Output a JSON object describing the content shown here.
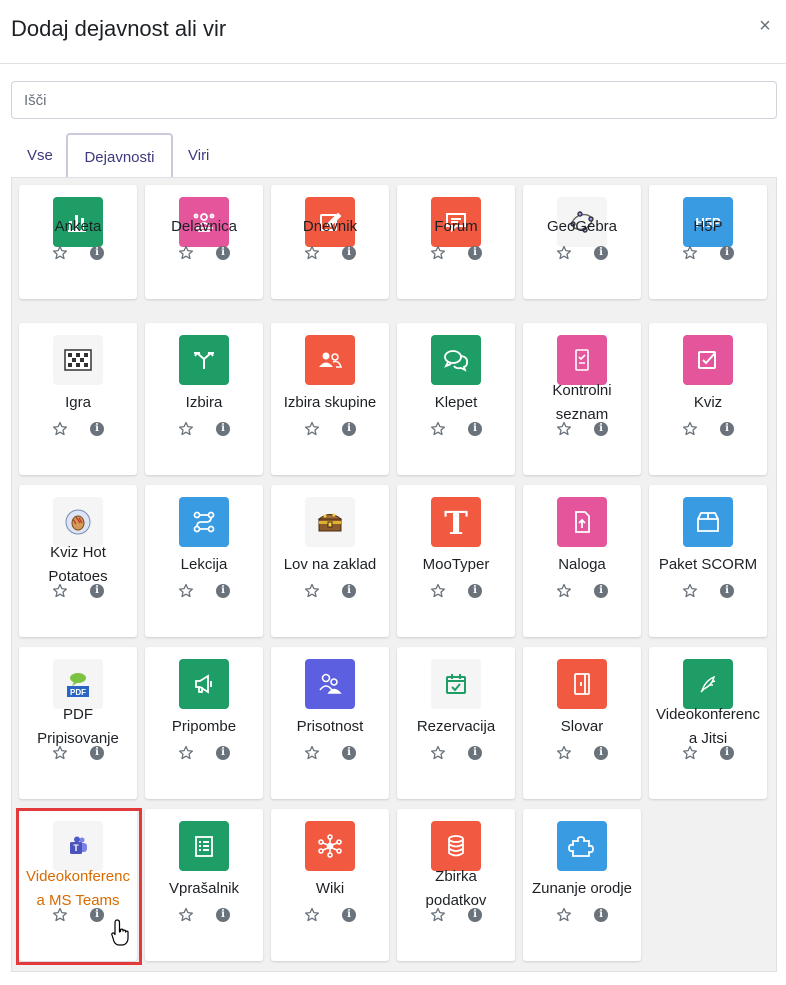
{
  "modal": {
    "title": "Dodaj dejavnost ali vir",
    "close_glyph": "×"
  },
  "search": {
    "placeholder": "Išči",
    "value": ""
  },
  "tabs": [
    {
      "label": "Vse",
      "active": false
    },
    {
      "label": "Dejavnosti",
      "active": true
    },
    {
      "label": "Viri",
      "active": false
    }
  ],
  "colors": {
    "green": "#1f9d67",
    "pink": "#e4559b",
    "red": "#f15a40",
    "blue": "#399be2",
    "purple": "#5b5fe0",
    "light": "#f5f5f5",
    "highlight": "#e23a3a",
    "highlight_text": "#d86a00"
  },
  "activities": [
    {
      "name": "Anketa",
      "icon": "chart-bar-icon",
      "color": "green"
    },
    {
      "name": "Delavnica",
      "icon": "people-icon",
      "color": "pink"
    },
    {
      "name": "Dnevnik",
      "icon": "edit-icon",
      "color": "red"
    },
    {
      "name": "Forum",
      "icon": "chat-bubble-icon",
      "color": "red"
    },
    {
      "name": "GeoGebra",
      "icon": "geogebra-icon",
      "color": "light"
    },
    {
      "name": "H5P",
      "icon": "h5p-icon",
      "color": "blue"
    },
    {
      "name": "Igra",
      "icon": "crossword-icon",
      "color": "light"
    },
    {
      "name": "Izbira",
      "icon": "signpost-icon",
      "color": "green"
    },
    {
      "name": "Izbira skupine",
      "icon": "group-icon",
      "color": "red"
    },
    {
      "name": "Klepet",
      "icon": "chat-icon",
      "color": "green"
    },
    {
      "name": "Kontrolni seznam",
      "icon": "checklist-icon",
      "color": "pink"
    },
    {
      "name": "Kviz",
      "icon": "checkbox-icon",
      "color": "pink"
    },
    {
      "name": "Kviz Hot Potatoes",
      "icon": "hot-potatoes-icon",
      "color": "light"
    },
    {
      "name": "Lekcija",
      "icon": "route-icon",
      "color": "blue"
    },
    {
      "name": "Lov na zaklad",
      "icon": "treasure-chest-icon",
      "color": "light"
    },
    {
      "name": "MooTyper",
      "icon": "letter-t-icon",
      "color": "red"
    },
    {
      "name": "Naloga",
      "icon": "file-upload-icon",
      "color": "pink"
    },
    {
      "name": "Paket SCORM",
      "icon": "package-icon",
      "color": "blue"
    },
    {
      "name": "PDF Pripisovanje",
      "icon": "pdf-icon",
      "color": "light"
    },
    {
      "name": "Pripombe",
      "icon": "megaphone-icon",
      "color": "green"
    },
    {
      "name": "Prisotnost",
      "icon": "attendance-icon",
      "color": "purple"
    },
    {
      "name": "Rezervacija",
      "icon": "calendar-check-icon",
      "color": "light"
    },
    {
      "name": "Slovar",
      "icon": "book-icon",
      "color": "red"
    },
    {
      "name": "Videokonferenc a Jitsi",
      "icon": "jitsi-icon",
      "color": "green"
    },
    {
      "name": "Videokonferenc a MS Teams",
      "icon": "teams-icon",
      "color": "light",
      "highlighted": true
    },
    {
      "name": "Vprašalnik",
      "icon": "list-icon",
      "color": "green"
    },
    {
      "name": "Wiki",
      "icon": "network-icon",
      "color": "red"
    },
    {
      "name": "Zbirka podatkov",
      "icon": "database-icon",
      "color": "red"
    },
    {
      "name": "Zunanje orodje",
      "icon": "puzzle-icon",
      "color": "blue"
    }
  ]
}
